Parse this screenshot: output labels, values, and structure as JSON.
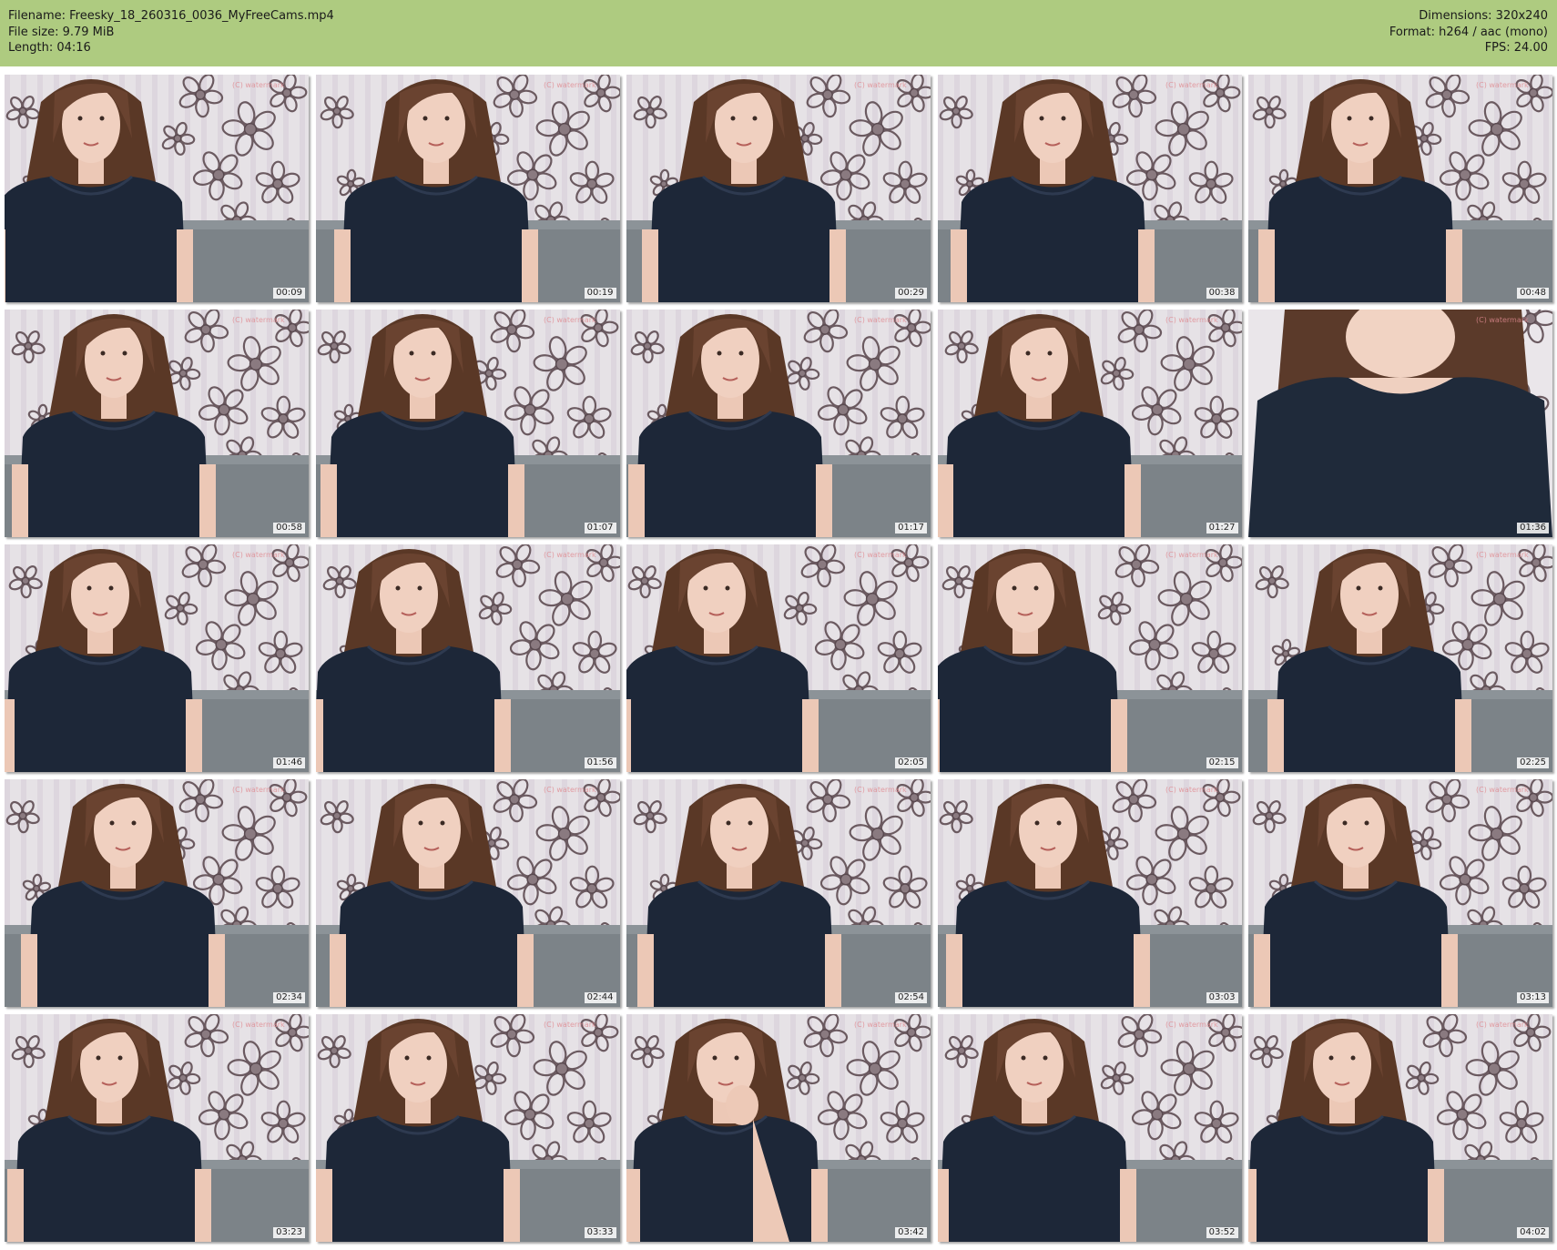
{
  "header": {
    "filename_line": "Filename: Freesky_18_260316_0036_MyFreeCams.mp4",
    "filesize_line": "File size: 9.79 MiB",
    "length_line": "Length: 04:16",
    "dimensions_line": "Dimensions: 320x240",
    "format_line": "Format: h264 / aac (mono)",
    "fps_line": "FPS: 24.00"
  },
  "colors": {
    "header_bg": "#aecb80",
    "page_bg": "#ffffff"
  },
  "thumbnails": [
    {
      "time": "00:09"
    },
    {
      "time": "00:19"
    },
    {
      "time": "00:29"
    },
    {
      "time": "00:38"
    },
    {
      "time": "00:48"
    },
    {
      "time": "00:58"
    },
    {
      "time": "01:07"
    },
    {
      "time": "01:17"
    },
    {
      "time": "01:27"
    },
    {
      "time": "01:36",
      "closeup": true
    },
    {
      "time": "01:46"
    },
    {
      "time": "01:56"
    },
    {
      "time": "02:05"
    },
    {
      "time": "02:15"
    },
    {
      "time": "02:25"
    },
    {
      "time": "02:34"
    },
    {
      "time": "02:44"
    },
    {
      "time": "02:54"
    },
    {
      "time": "03:03"
    },
    {
      "time": "03:13"
    },
    {
      "time": "03:23"
    },
    {
      "time": "03:33"
    },
    {
      "time": "03:42",
      "hand": true
    },
    {
      "time": "03:52"
    },
    {
      "time": "04:02"
    }
  ]
}
